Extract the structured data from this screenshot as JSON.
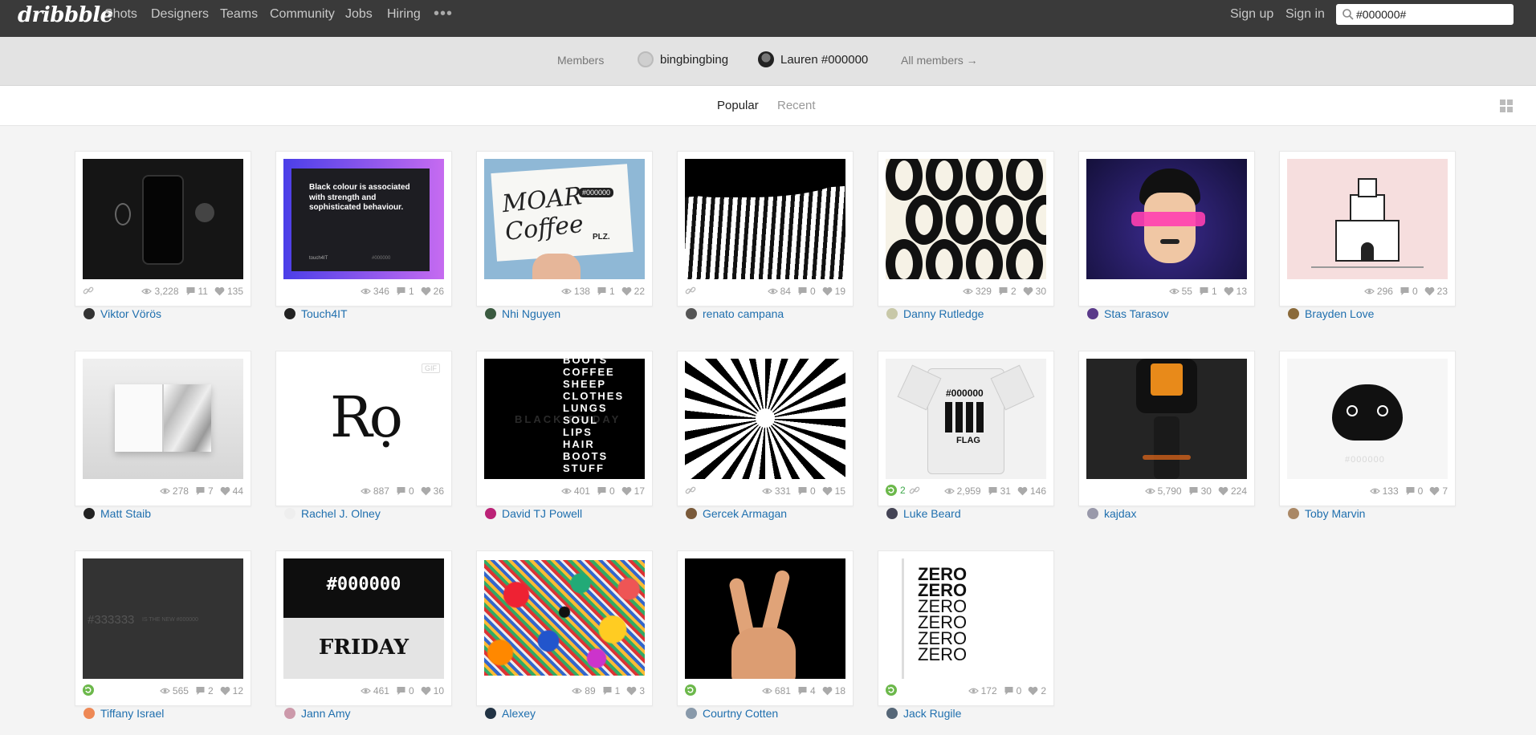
{
  "nav": {
    "logo": "dribbble",
    "links": [
      "Shots",
      "Designers",
      "Teams",
      "Community",
      "Jobs",
      "Hiring"
    ],
    "more": "•••",
    "signup": "Sign up",
    "signin": "Sign in",
    "search_value": "#000000#"
  },
  "members": {
    "label": "Members",
    "m1": "bingbingbing",
    "m2": "Lauren #000000",
    "all": "All members →"
  },
  "filters": {
    "popular": "Popular",
    "recent": "Recent"
  },
  "shots": [
    {
      "views": "3,228",
      "comments": "11",
      "likes": "135",
      "author": "Viktor Vörös",
      "link": true
    },
    {
      "views": "346",
      "comments": "1",
      "likes": "26",
      "author": "Touch4IT",
      "thumb_text": "Black colour is associated with strength and sophisticated behaviour.",
      "thumb_small": "touch4IT",
      "thumb_hex": "#000000"
    },
    {
      "views": "138",
      "comments": "1",
      "likes": "22",
      "author": "Nhi Nguyen",
      "thumb_text": "MOAR Coffee",
      "thumb_small": "PLZ.",
      "thumb_hex": "#000000"
    },
    {
      "views": "84",
      "comments": "0",
      "likes": "19",
      "author": "renato campana",
      "link": true
    },
    {
      "views": "329",
      "comments": "2",
      "likes": "30",
      "author": "Danny Rutledge"
    },
    {
      "views": "55",
      "comments": "1",
      "likes": "13",
      "author": "Stas Tarasov"
    },
    {
      "views": "296",
      "comments": "0",
      "likes": "23",
      "author": "Brayden Love"
    },
    {
      "views": "278",
      "comments": "7",
      "likes": "44",
      "author": "Matt Staib"
    },
    {
      "views": "887",
      "comments": "0",
      "likes": "36",
      "author": "Rachel J. Olney",
      "gif": "GIF",
      "thumb_text": "Rọ"
    },
    {
      "views": "401",
      "comments": "0",
      "likes": "17",
      "author": "David TJ Powell",
      "thumb_words": [
        "BOOTS",
        "COFFEE",
        "SHEEP",
        "CLOTHES",
        "LUNGS",
        "SOUL",
        "LIPS",
        "HAIR",
        "BOOTS",
        "STUFF"
      ],
      "thumb_ghost": "BLACK FRIDAY"
    },
    {
      "views": "331",
      "comments": "0",
      "likes": "15",
      "author": "Gercek Armagan",
      "link": true
    },
    {
      "views": "2,959",
      "comments": "31",
      "likes": "146",
      "author": "Luke Beard",
      "rebounds": "2",
      "link": true,
      "thumb_text": "#000000",
      "thumb_small": "FLAG"
    },
    {
      "views": "5,790",
      "comments": "30",
      "likes": "224",
      "author": "kajdax"
    },
    {
      "views": "133",
      "comments": "0",
      "likes": "7",
      "author": "Toby Marvin",
      "thumb_small": "#000000"
    },
    {
      "views": "565",
      "comments": "2",
      "likes": "12",
      "author": "Tiffany Israel",
      "rebound": true,
      "thumb_text": "#333333",
      "thumb_small": "IS THE NEW #000000"
    },
    {
      "views": "461",
      "comments": "0",
      "likes": "10",
      "author": "Jann Amy",
      "thumb_text": "#000000",
      "thumb_small": "FRIDAY"
    },
    {
      "views": "89",
      "comments": "1",
      "likes": "3",
      "author": "Alexey"
    },
    {
      "views": "681",
      "comments": "4",
      "likes": "18",
      "author": "Courtny Cotten",
      "rebound": true
    },
    {
      "views": "172",
      "comments": "0",
      "likes": "2",
      "author": "Jack Rugile",
      "rebound": true,
      "thumb_words": [
        "ZERO",
        "ZERO",
        "ZERO",
        "ZERO",
        "ZERO",
        "ZERO"
      ]
    }
  ],
  "colors": {
    "nav_bg": "#3a3a3a",
    "link_blue": "#1f6fae",
    "rebound_green": "#3fa94b",
    "page_bg": "#f4f4f4"
  },
  "icons": [
    "search-icon",
    "grid-view-icon",
    "views-icon",
    "comments-icon",
    "likes-icon",
    "attachment-icon",
    "rebound-icon"
  ]
}
